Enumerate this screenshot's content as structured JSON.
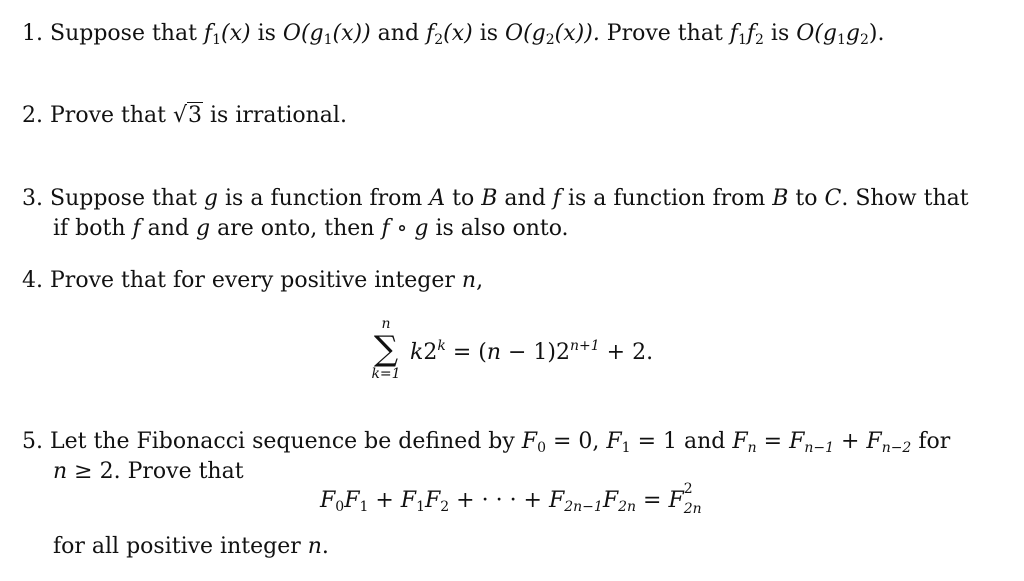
{
  "problems": [
    {
      "number": "1.",
      "parts": {
        "t1": "Suppose that ",
        "f1": "f",
        "s1": "1",
        "x1": "(x)",
        "t2": " is ",
        "O1": "O",
        "g1": "(g",
        "gs1": "1",
        "x2": "(x))",
        "t3": " and ",
        "f2": "f",
        "s2": "2",
        "x3": "(x)",
        "t4": " is ",
        "O2": "O",
        "g2": "(g",
        "gs2": "2",
        "x4": "(x)).",
        "t5": " Prove that ",
        "pf1": "f",
        "ps1": "1",
        "pf2": "f",
        "ps2": "2",
        "t6": " is ",
        "O3": "O",
        "pg": "(g",
        "pgs1": "1",
        "pg2": "g",
        "pgs2": "2",
        "end": ")."
      }
    },
    {
      "number": "2.",
      "parts": {
        "t1": "Prove that ",
        "radical": "√",
        "radicand": "3",
        "t2": " is irrational."
      }
    },
    {
      "number": "3.",
      "line1": {
        "t1": "Suppose that ",
        "g": "g",
        "t2": " is a function from ",
        "A": "A",
        "t3": " to ",
        "B": "B",
        "t4": " and ",
        "f": "f",
        "t5": " is a function from ",
        "B2": "B",
        "t6": " to ",
        "C": "C",
        "t7": ". Show that"
      },
      "line2": {
        "t1": "if both ",
        "f": "f",
        "t2": " and ",
        "g": "g",
        "t3": " are onto, then ",
        "comp": "f ∘ g",
        "t4": " is also onto."
      }
    },
    {
      "number": "4.",
      "text": "Prove that for every positive integer ",
      "var": "n",
      "comma": ",",
      "formula": {
        "sum_upper": "n",
        "sum_symbol": "∑",
        "sum_lower": "k=1",
        "term": "k",
        "term_base": "2",
        "term_exp": "k",
        "rhs_a": " = (",
        "rhs_n": "n",
        "rhs_b": " − 1)2",
        "rhs_exp": "n+1",
        "rhs_c": " + 2."
      }
    },
    {
      "number": "5.",
      "line1": {
        "t1": "Let the Fibonacci sequence be defined by ",
        "F0": "F",
        "F0s": "0",
        "e1": " = 0, ",
        "F1": "F",
        "F1s": "1",
        "e2": " = 1 and ",
        "Fn": "F",
        "Fns": "n",
        "e3": " = ",
        "Fa": "F",
        "Fas": "n−1",
        "plus": " + ",
        "Fb": "F",
        "Fbs": "n−2",
        "t2": " for"
      },
      "line2": {
        "n": "n",
        "t1": " ≥ 2. Prove that"
      },
      "formula": {
        "a": "F",
        "as": "0",
        "b": "F",
        "bs": "1",
        "p1": " + ",
        "c": "F",
        "cs": "1",
        "d": "F",
        "ds": "2",
        "p2": " + · · · + ",
        "e": "F",
        "es": "2n−1",
        "f": "F",
        "fs": "2n",
        "eq": " = ",
        "g": "F",
        "gsup": "2",
        "gsub": "2n"
      },
      "closing": {
        "t1": "for all positive integer ",
        "n": "n",
        "end": "."
      }
    }
  ]
}
